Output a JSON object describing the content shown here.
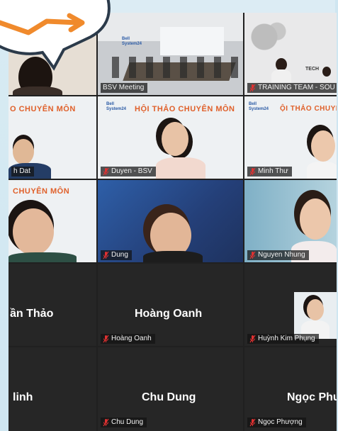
{
  "tiles": [
    {
      "name": "BSV Meeting"
    },
    {
      "name": "TRAINING TEAM - SOU"
    },
    {
      "name": "h Dat"
    },
    {
      "name": "Duyen - BSV"
    },
    {
      "name": "Minh Thư"
    },
    {
      "name": "Dung"
    },
    {
      "name": "Nguyen Nhung"
    }
  ],
  "banner": {
    "title": "HỘI THẢO CHUYÊN MÔN",
    "title_cut": "O CHUYÊN MÔN",
    "title_cut2": "ỘI THẢO CHUYÊN MÔN",
    "title_cut3": "CHUYÊN MÔN",
    "logo_line1": "Bell",
    "logo_line2": "System24",
    "office_logo_line1": "Bell",
    "office_logo_line2": "System24",
    "tech_sign": "TECH"
  },
  "avatar_tiles": [
    {
      "big": "ần Thảo",
      "plate": ""
    },
    {
      "big": "Hoàng Oanh",
      "plate": "Hoàng Oanh"
    },
    {
      "big": "",
      "plate": "Huỳnh Kim Phụng"
    },
    {
      "big": "linh",
      "plate": ""
    },
    {
      "big": "Chu Dung",
      "plate": "Chu Dung"
    },
    {
      "big": "Ngọc Phư",
      "plate": "Ngọc Phượng"
    }
  ],
  "colors": {
    "grid_bg": "#202020",
    "banner_orange": "#e0602a",
    "mic_red": "#e03131"
  }
}
